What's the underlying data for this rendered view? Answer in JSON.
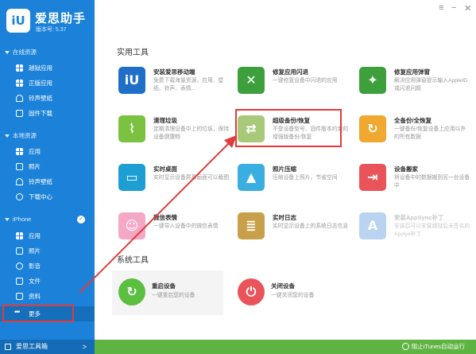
{
  "app": {
    "title": "爱思助手",
    "version": "版本号: 5.37",
    "logo_text": "iU"
  },
  "sidebar": {
    "sections": [
      {
        "label": "在线资源",
        "items": [
          {
            "label": "越狱应用",
            "icon": "apps-grid-icon"
          },
          {
            "label": "正版应用",
            "icon": "apps-grid-icon"
          },
          {
            "label": "铃声壁纸",
            "icon": "bell-icon"
          },
          {
            "label": "固件下载",
            "icon": "download-icon"
          }
        ]
      },
      {
        "label": "本地资源",
        "items": [
          {
            "label": "应用",
            "icon": "apps-grid-icon"
          },
          {
            "label": "照片",
            "icon": "photo-icon"
          },
          {
            "label": "铃声壁纸",
            "icon": "bell-icon"
          },
          {
            "label": "下载中心",
            "icon": "download-icon"
          }
        ]
      },
      {
        "label": "iPhone",
        "items": [
          {
            "label": "应用",
            "icon": "apps-grid-icon"
          },
          {
            "label": "照片",
            "icon": "photo-icon"
          },
          {
            "label": "影音",
            "icon": "music-icon"
          },
          {
            "label": "文件",
            "icon": "file-icon"
          },
          {
            "label": "资料",
            "icon": "contacts-icon"
          },
          {
            "label": "更多",
            "icon": "more-dots-icon"
          }
        ]
      }
    ],
    "bottom": "爱思工具箱"
  },
  "main": {
    "tools_title": "实用工具",
    "tools": [
      {
        "name": "安装爱思移动端",
        "desc": "免费下载海量资源，应用、壁纸、铃声、表情...",
        "color": "#1f6fc8",
        "icon": "aisi-mobile-icon"
      },
      {
        "name": "修复应用闪退",
        "desc": "一键修复设备中闪退的应用",
        "color": "#3da03d",
        "icon": "wrench-screwdriver-icon"
      },
      {
        "name": "修复应用弹窗",
        "desc": "解决应用弹窗提示输入AppleID或闪退问题",
        "color": "#3da03d",
        "icon": "magic-wand-icon"
      },
      {
        "name": "清理垃圾",
        "desc": "定期清理设备中上的垃圾，保持设备健康畅",
        "color": "#7cc241",
        "icon": "broom-icon"
      },
      {
        "name": "超级备份/恢复",
        "desc": "不受设备型号、固件版本约束的增强版备份/恢复",
        "color": "#a9c97a",
        "icon": "backup-shuffle-icon"
      },
      {
        "name": "全备份/全恢复",
        "desc": "一键备份/恢复设备上应用以外的所有数据",
        "color": "#f0a830",
        "icon": "sync-icon"
      },
      {
        "name": "实时桌面",
        "desc": "实时显示设备屏幕画面可以截图",
        "color": "#1e9fd4",
        "icon": "monitor-icon"
      },
      {
        "name": "照片压缩",
        "desc": "压缩设备上照片，节省空间",
        "color": "#3aaee0",
        "icon": "image-icon"
      },
      {
        "name": "设备搬家",
        "desc": "将设备中的数据搬到另一台设备中",
        "color": "#e9545a",
        "icon": "transfer-icon"
      },
      {
        "name": "微信表情",
        "desc": "一键导入设备中的微信表情",
        "color": "#f5a8c5",
        "icon": "emoji-face-icon"
      },
      {
        "name": "实时日志",
        "desc": "实时显示设备上的系统日志信息",
        "color": "#c9a04a",
        "icon": "log-icon"
      },
      {
        "name": "安装AppSync补丁",
        "desc": "安装后可以安装越狱后未签名的Applye补丁",
        "color": "#3a85d6",
        "icon": "appstore-icon",
        "dim": true
      }
    ],
    "system_title": "系统工具",
    "system": [
      {
        "name": "重启设备",
        "desc": "一键重启您的设备",
        "color": "#5bbf3f",
        "icon": "restart-icon"
      },
      {
        "name": "关闭设备",
        "desc": "一键关闭您的设备",
        "color": "#e9545a",
        "icon": "power-icon"
      }
    ]
  },
  "status": {
    "text": "阻止iTunes自动运行"
  },
  "colors": {
    "sidebar": "#1c82d9",
    "statusbar": "#5fb342",
    "highlight": "#e23b3b"
  }
}
